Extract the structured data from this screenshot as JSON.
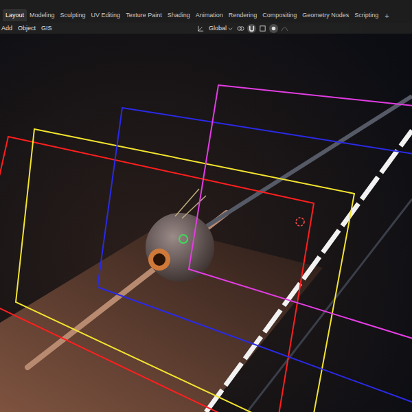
{
  "window": {
    "title": "Blender"
  },
  "workspace_tabs": [
    {
      "label": "Layout",
      "selected": true
    },
    {
      "label": "Modeling",
      "selected": false
    },
    {
      "label": "Sculpting",
      "selected": false
    },
    {
      "label": "UV Editing",
      "selected": false
    },
    {
      "label": "Texture Paint",
      "selected": false
    },
    {
      "label": "Shading",
      "selected": false
    },
    {
      "label": "Animation",
      "selected": false
    },
    {
      "label": "Rendering",
      "selected": false
    },
    {
      "label": "Compositing",
      "selected": false
    },
    {
      "label": "Geometry Nodes",
      "selected": false
    },
    {
      "label": "Scripting",
      "selected": false
    }
  ],
  "add_tab": "+",
  "header": {
    "menus": [
      "Add",
      "Object",
      "GIS"
    ],
    "orientation": "Global"
  },
  "camera_frames": [
    {
      "color": "#ff1f1f"
    },
    {
      "color": "#f2e430"
    },
    {
      "color": "#2a2ae6"
    },
    {
      "color": "#e23de2"
    }
  ]
}
